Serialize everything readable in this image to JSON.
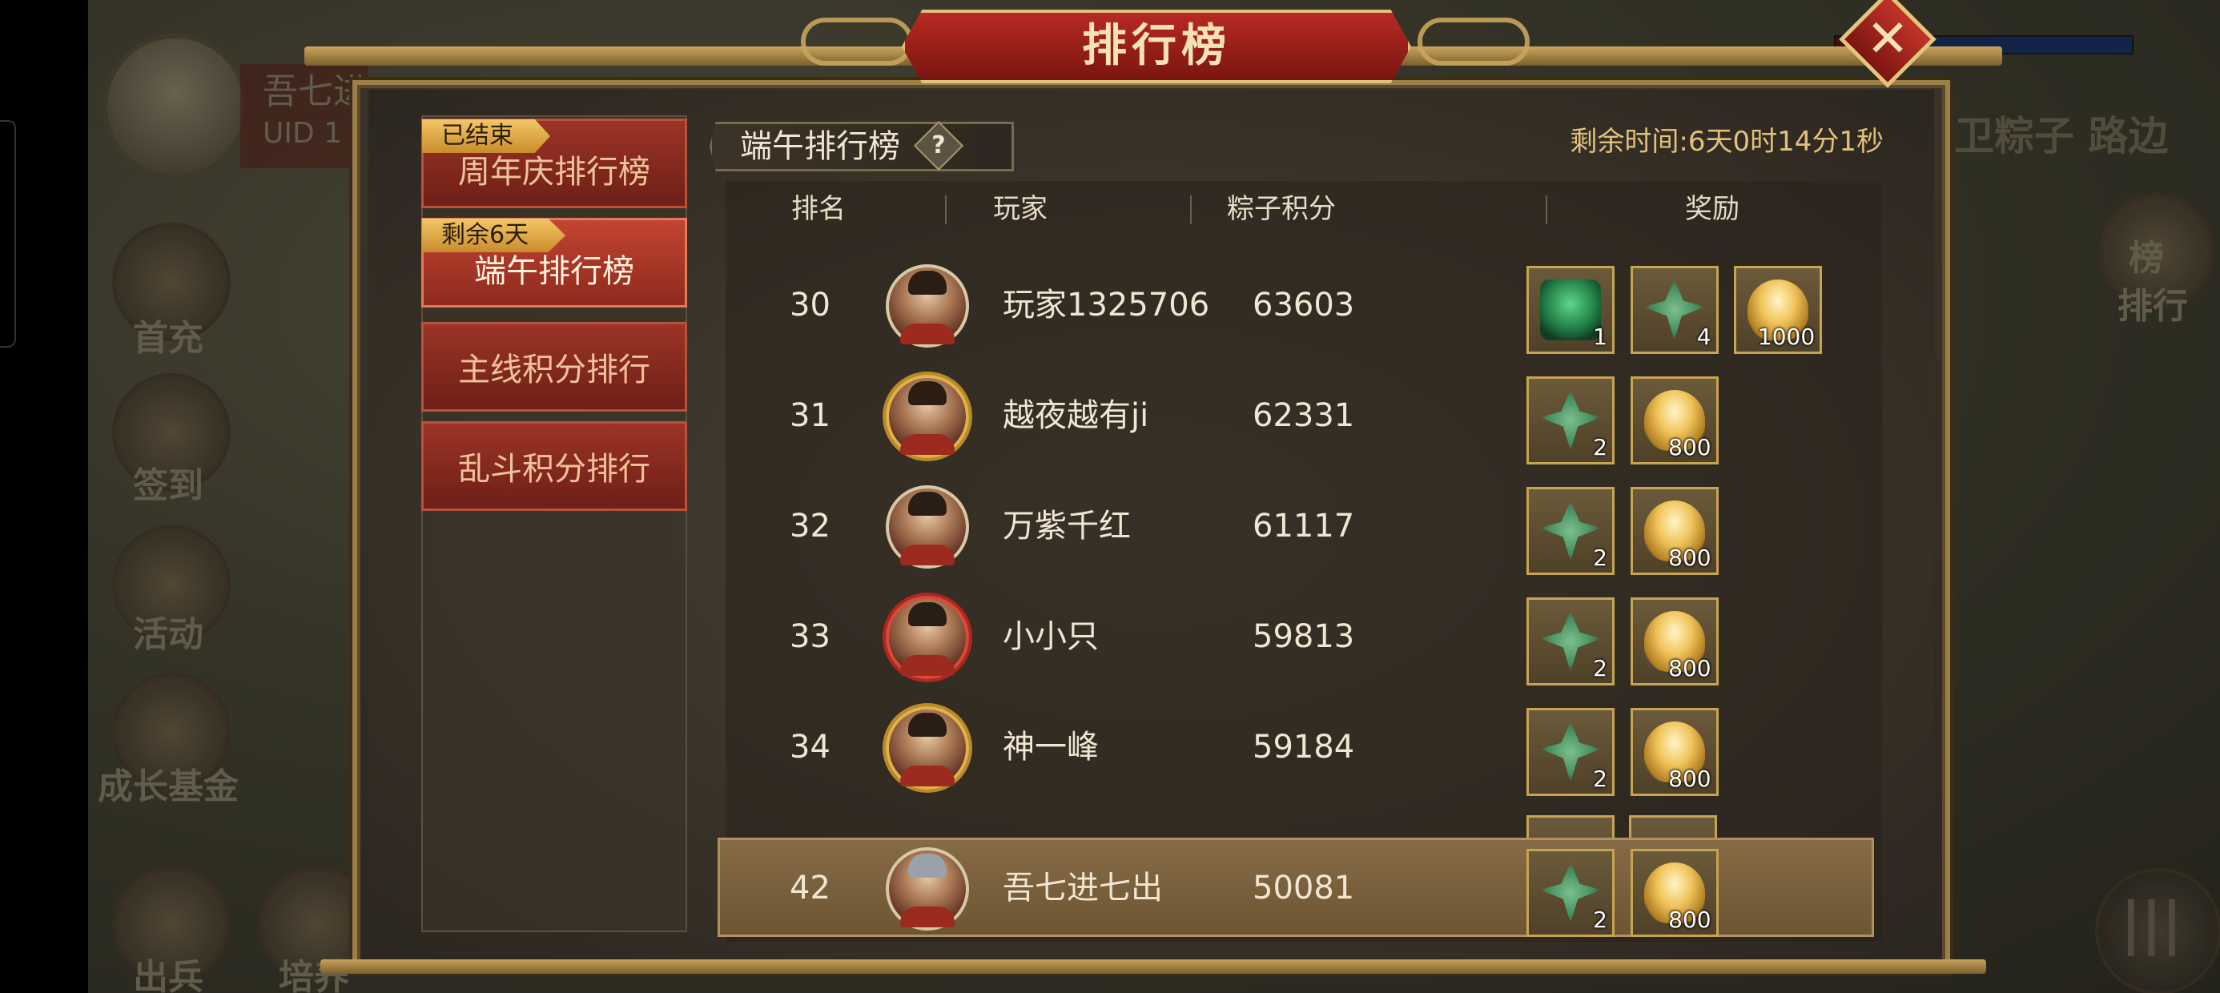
{
  "background": {
    "player_name_fragment": "吾七进",
    "uid_label": "UID",
    "uid_fragment": "1",
    "side_menu": [
      {
        "label": "首充"
      },
      {
        "label": "签到"
      },
      {
        "label": "活动"
      },
      {
        "label": "成长基金"
      },
      {
        "label": "出兵"
      },
      {
        "label": "培养"
      }
    ],
    "right_button_label": "排行",
    "right_ranking_icon_char": "榜",
    "right_banner_text": "卫粽子 路边"
  },
  "window": {
    "title": "排行榜",
    "close_icon": "close-x-icon"
  },
  "tabs": [
    {
      "label": "周年庆排行榜",
      "badge": "已结束",
      "active": false
    },
    {
      "label": "端午排行榜",
      "badge": "剩余6天",
      "active": true
    },
    {
      "label": "主线积分排行",
      "badge": "",
      "active": false
    },
    {
      "label": "乱斗积分排行",
      "badge": "",
      "active": false
    }
  ],
  "content": {
    "subtitle": "端午排行榜",
    "help_symbol": "?",
    "remaining_time": "剩余时间:6天0时14分1秒",
    "columns": {
      "rank": "排名",
      "player": "玩家",
      "score": "粽子积分",
      "reward": "奖励"
    },
    "rows": [
      {
        "rank": "30",
        "player": "玩家1325706",
        "score": "63603",
        "frame": "plain",
        "rewards": [
          {
            "icon": "jade-beast-icon",
            "count": "1"
          },
          {
            "icon": "zongzi-leaf-icon",
            "count": "4"
          },
          {
            "icon": "gold-ingot-icon",
            "count": "1000"
          }
        ]
      },
      {
        "rank": "31",
        "player": "越夜越有ji",
        "score": "62331",
        "frame": "gold",
        "rewards": [
          {
            "icon": "zongzi-leaf-icon",
            "count": "2"
          },
          {
            "icon": "gold-ingot-icon",
            "count": "800"
          }
        ]
      },
      {
        "rank": "32",
        "player": "万紫千红",
        "score": "61117",
        "frame": "plain",
        "rewards": [
          {
            "icon": "zongzi-leaf-icon",
            "count": "2"
          },
          {
            "icon": "gold-ingot-icon",
            "count": "800"
          }
        ]
      },
      {
        "rank": "33",
        "player": "小小只",
        "score": "59813",
        "frame": "red",
        "rewards": [
          {
            "icon": "zongzi-leaf-icon",
            "count": "2"
          },
          {
            "icon": "gold-ingot-icon",
            "count": "800"
          }
        ]
      },
      {
        "rank": "34",
        "player": "神一峰",
        "score": "59184",
        "frame": "gold",
        "rewards": [
          {
            "icon": "zongzi-leaf-icon",
            "count": "2"
          },
          {
            "icon": "gold-ingot-icon",
            "count": "800"
          }
        ]
      }
    ],
    "self_row": {
      "rank": "42",
      "player": "吾七进七出",
      "score": "50081",
      "frame": "silver",
      "rewards": [
        {
          "icon": "zongzi-leaf-icon",
          "count": "2"
        },
        {
          "icon": "gold-ingot-icon",
          "count": "800"
        }
      ]
    }
  },
  "colors": {
    "accent_gold": "#e3c07c",
    "title_red": "#b72a22",
    "tab_red": "#9b3427"
  }
}
